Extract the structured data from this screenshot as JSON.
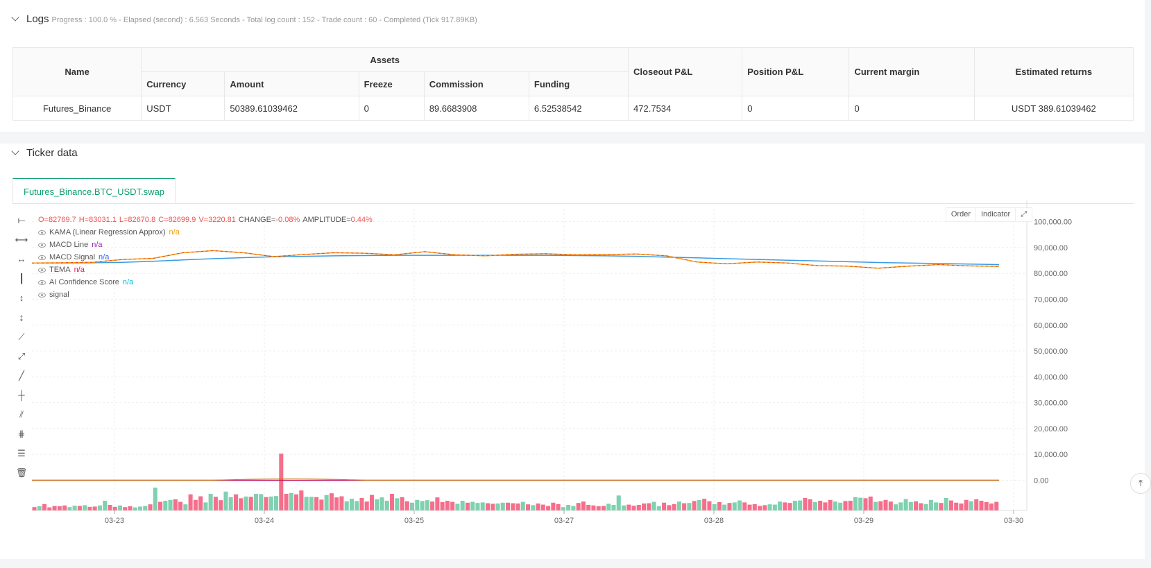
{
  "logs": {
    "title": "Logs",
    "status": "Progress : 100.0 % - Elapsed (second) : 6.563  Seconds - Total log count : 152 - Trade count : 60 - Completed (Tick 917.89KB)",
    "table": {
      "group_header": "Assets",
      "headers": {
        "name": "Name",
        "currency": "Currency",
        "amount": "Amount",
        "freeze": "Freeze",
        "commission": "Commission",
        "funding": "Funding",
        "closeout": "Closeout P&L",
        "position": "Position P&L",
        "margin": "Current margin",
        "returns": "Estimated returns"
      },
      "row": {
        "name": "Futures_Binance",
        "currency": "USDT",
        "amount": "50389.61039462",
        "freeze": "0",
        "commission": "89.6683908",
        "funding": "6.52538542",
        "closeout": "472.7534",
        "position": "0",
        "margin": "0",
        "returns": "USDT 389.61039462"
      }
    }
  },
  "ticker": {
    "title": "Ticker data",
    "tab": "Futures_Binance.BTC_USDT.swap",
    "buttons": {
      "order": "Order",
      "indicator": "Indicator"
    },
    "ohlc": {
      "o": "O=82769.7",
      "h": "H=83031.1",
      "l": "L=82670.8",
      "c": "C=82699.9",
      "v": "V=3220.81",
      "change_label": "CHANGE=",
      "change": "-0.08%",
      "amp_label": "AMPLITUDE=",
      "amp": "0.44%"
    },
    "legend": [
      {
        "name": "KAMA (Linear Regression Approx)",
        "value": "n/a",
        "color": "#f59e0b"
      },
      {
        "name": "MACD Line",
        "value": "n/a",
        "color": "#9c27b0"
      },
      {
        "name": "MACD Signal",
        "value": "n/a",
        "color": "#2962ff"
      },
      {
        "name": "TEMA",
        "value": "n/a",
        "color": "#e91e63"
      },
      {
        "name": "AI Confidence Score",
        "value": "n/a",
        "color": "#00bcd4"
      },
      {
        "name": "signal",
        "value": "",
        "color": "#999999"
      }
    ]
  },
  "chart_data": {
    "type": "line",
    "x_ticks": [
      "03-23",
      "03-24",
      "03-25",
      "03-27",
      "03-28",
      "03-29",
      "03-30"
    ],
    "y_ticks": [
      "100,000.00",
      "90,000.00",
      "80,000.00",
      "70,000.00",
      "60,000.00",
      "50,000.00",
      "40,000.00",
      "30,000.00",
      "20,000.00",
      "10,000.00",
      "0.00"
    ],
    "ylim": [
      -9000,
      105000
    ],
    "price": [
      84000,
      84100,
      84300,
      85400,
      85800,
      88000,
      88800,
      88000,
      86500,
      87300,
      88000,
      87800,
      87200,
      88400,
      87200,
      86800,
      87400,
      87600,
      87200,
      87300,
      87500,
      86800,
      84400,
      83700,
      84400,
      84000,
      83000,
      82800,
      82000,
      82800,
      83400,
      82900,
      82700
    ],
    "slow_line": [
      84000,
      84000,
      84100,
      84300,
      84700,
      85200,
      85700,
      86100,
      86400,
      86600,
      86800,
      86900,
      87000,
      87000,
      87000,
      87000,
      87000,
      87000,
      86900,
      86800,
      86600,
      86300,
      86000,
      85700,
      85400,
      85100,
      84800,
      84500,
      84200,
      84000,
      83800,
      83600,
      83400
    ],
    "volume_dir": [
      "d",
      "u",
      "d",
      "d",
      "d",
      "d",
      "d",
      "u",
      "u",
      "d",
      "u",
      "d",
      "d",
      "u",
      "u",
      "d",
      "d",
      "u",
      "d",
      "d",
      "u",
      "u",
      "u",
      "d",
      "u",
      "d",
      "u",
      "u",
      "d",
      "d",
      "u",
      "d",
      "d",
      "d",
      "u",
      "u",
      "d",
      "d",
      "u",
      "u",
      "d",
      "d",
      "u",
      "d",
      "u",
      "u",
      "d",
      "u",
      "u",
      "d",
      "d",
      "u",
      "d",
      "d",
      "u",
      "u",
      "d",
      "d",
      "u",
      "d",
      "d",
      "d",
      "u",
      "u",
      "u",
      "d",
      "d",
      "d",
      "u",
      "u",
      "u",
      "d",
      "u",
      "d",
      "d",
      "u",
      "u",
      "u",
      "u",
      "d",
      "d",
      "d",
      "d",
      "d",
      "u",
      "u",
      "d",
      "u",
      "u",
      "u",
      "d",
      "d",
      "u",
      "u",
      "d",
      "d",
      "d",
      "u",
      "d",
      "u",
      "d",
      "d",
      "d",
      "d",
      "d",
      "u",
      "u",
      "u",
      "d",
      "d",
      "d",
      "d",
      "d",
      "d",
      "u",
      "u",
      "u",
      "u",
      "d",
      "d",
      "d",
      "d",
      "d",
      "u",
      "u",
      "d",
      "d",
      "d",
      "u",
      "d",
      "u",
      "d",
      "u",
      "d",
      "d",
      "u",
      "d",
      "u",
      "d",
      "u",
      "u",
      "d",
      "d",
      "d",
      "d",
      "d",
      "u",
      "u",
      "u",
      "d",
      "d",
      "u",
      "u",
      "d",
      "d",
      "u",
      "d",
      "d",
      "d",
      "u",
      "u",
      "d",
      "d",
      "u",
      "u",
      "d",
      "d",
      "u",
      "d",
      "d",
      "d",
      "u",
      "u",
      "u",
      "u",
      "d",
      "d",
      "u",
      "u",
      "u",
      "d",
      "u",
      "d",
      "d",
      "d"
    ],
    "volume": [
      1.2,
      1.5,
      2.3,
      1.1,
      1.6,
      1.5,
      1.8,
      1.2,
      1.7,
      1.6,
      1.9,
      1.3,
      1.4,
      1.8,
      3.5,
      2.0,
      1.3,
      1.8,
      1.2,
      1.5,
      1.1,
      1.4,
      1.6,
      2.2,
      8.2,
      3.1,
      3.5,
      3.8,
      4.0,
      3.1,
      2.2,
      5.8,
      3.8,
      5.1,
      2.9,
      6.0,
      4.9,
      3.7,
      6.8,
      4.8,
      5.8,
      4.4,
      5.0,
      4.9,
      6.0,
      5.9,
      4.8,
      5.0,
      5.2,
      20.5,
      6.0,
      6.3,
      5.8,
      7.2,
      4.9,
      4.9,
      4.8,
      3.9,
      5.5,
      6.2,
      4.7,
      5.1,
      3.3,
      4.2,
      3.4,
      4.5,
      3.2,
      5.6,
      4.0,
      4.7,
      3.5,
      6.0,
      4.4,
      4.8,
      3.3,
      2.8,
      3.8,
      3.4,
      3.7,
      3.2,
      4.7,
      3.0,
      3.5,
      3.1,
      2.4,
      3.5,
      2.8,
      3.1,
      2.7,
      2.9,
      2.6,
      2.4,
      2.5,
      2.8,
      2.8,
      2.6,
      2.5,
      3.1,
      2.2,
      1.9,
      2.5,
      2.1,
      1.6,
      2.8,
      2.3,
      1.2,
      2.0,
      1.6,
      2.7,
      3.2,
      2.0,
      1.8,
      1.5,
      1.6,
      2.4,
      2.0,
      5.4,
      1.8,
      2.1,
      1.7,
      2.0,
      2.5,
      2.6,
      3.1,
      1.5,
      2.8,
      1.9,
      2.3,
      3.2,
      2.6,
      2.7,
      3.4,
      3.8,
      4.2,
      3.3,
      2.3,
      3.0,
      2.1,
      2.7,
      2.9,
      3.6,
      2.9,
      2.1,
      2.3,
      1.6,
      1.9,
      2.2,
      2.1,
      3.2,
      2.9,
      2.7,
      3.5,
      3.6,
      4.5,
      4.0,
      3.0,
      3.5,
      2.9,
      3.8,
      3.2,
      2.8,
      3.4,
      3.5,
      4.8,
      4.6,
      4.4,
      5.0,
      3.1,
      3.3,
      3.8,
      3.2,
      2.2,
      2.9,
      4.1,
      3.0,
      3.3,
      2.6,
      2.3,
      3.8,
      2.9,
      2.7,
      4.5,
      3.6,
      2.8,
      2.5,
      3.8,
      3.3,
      4.0,
      3.5,
      3.0,
      2.5,
      3.1
    ]
  }
}
